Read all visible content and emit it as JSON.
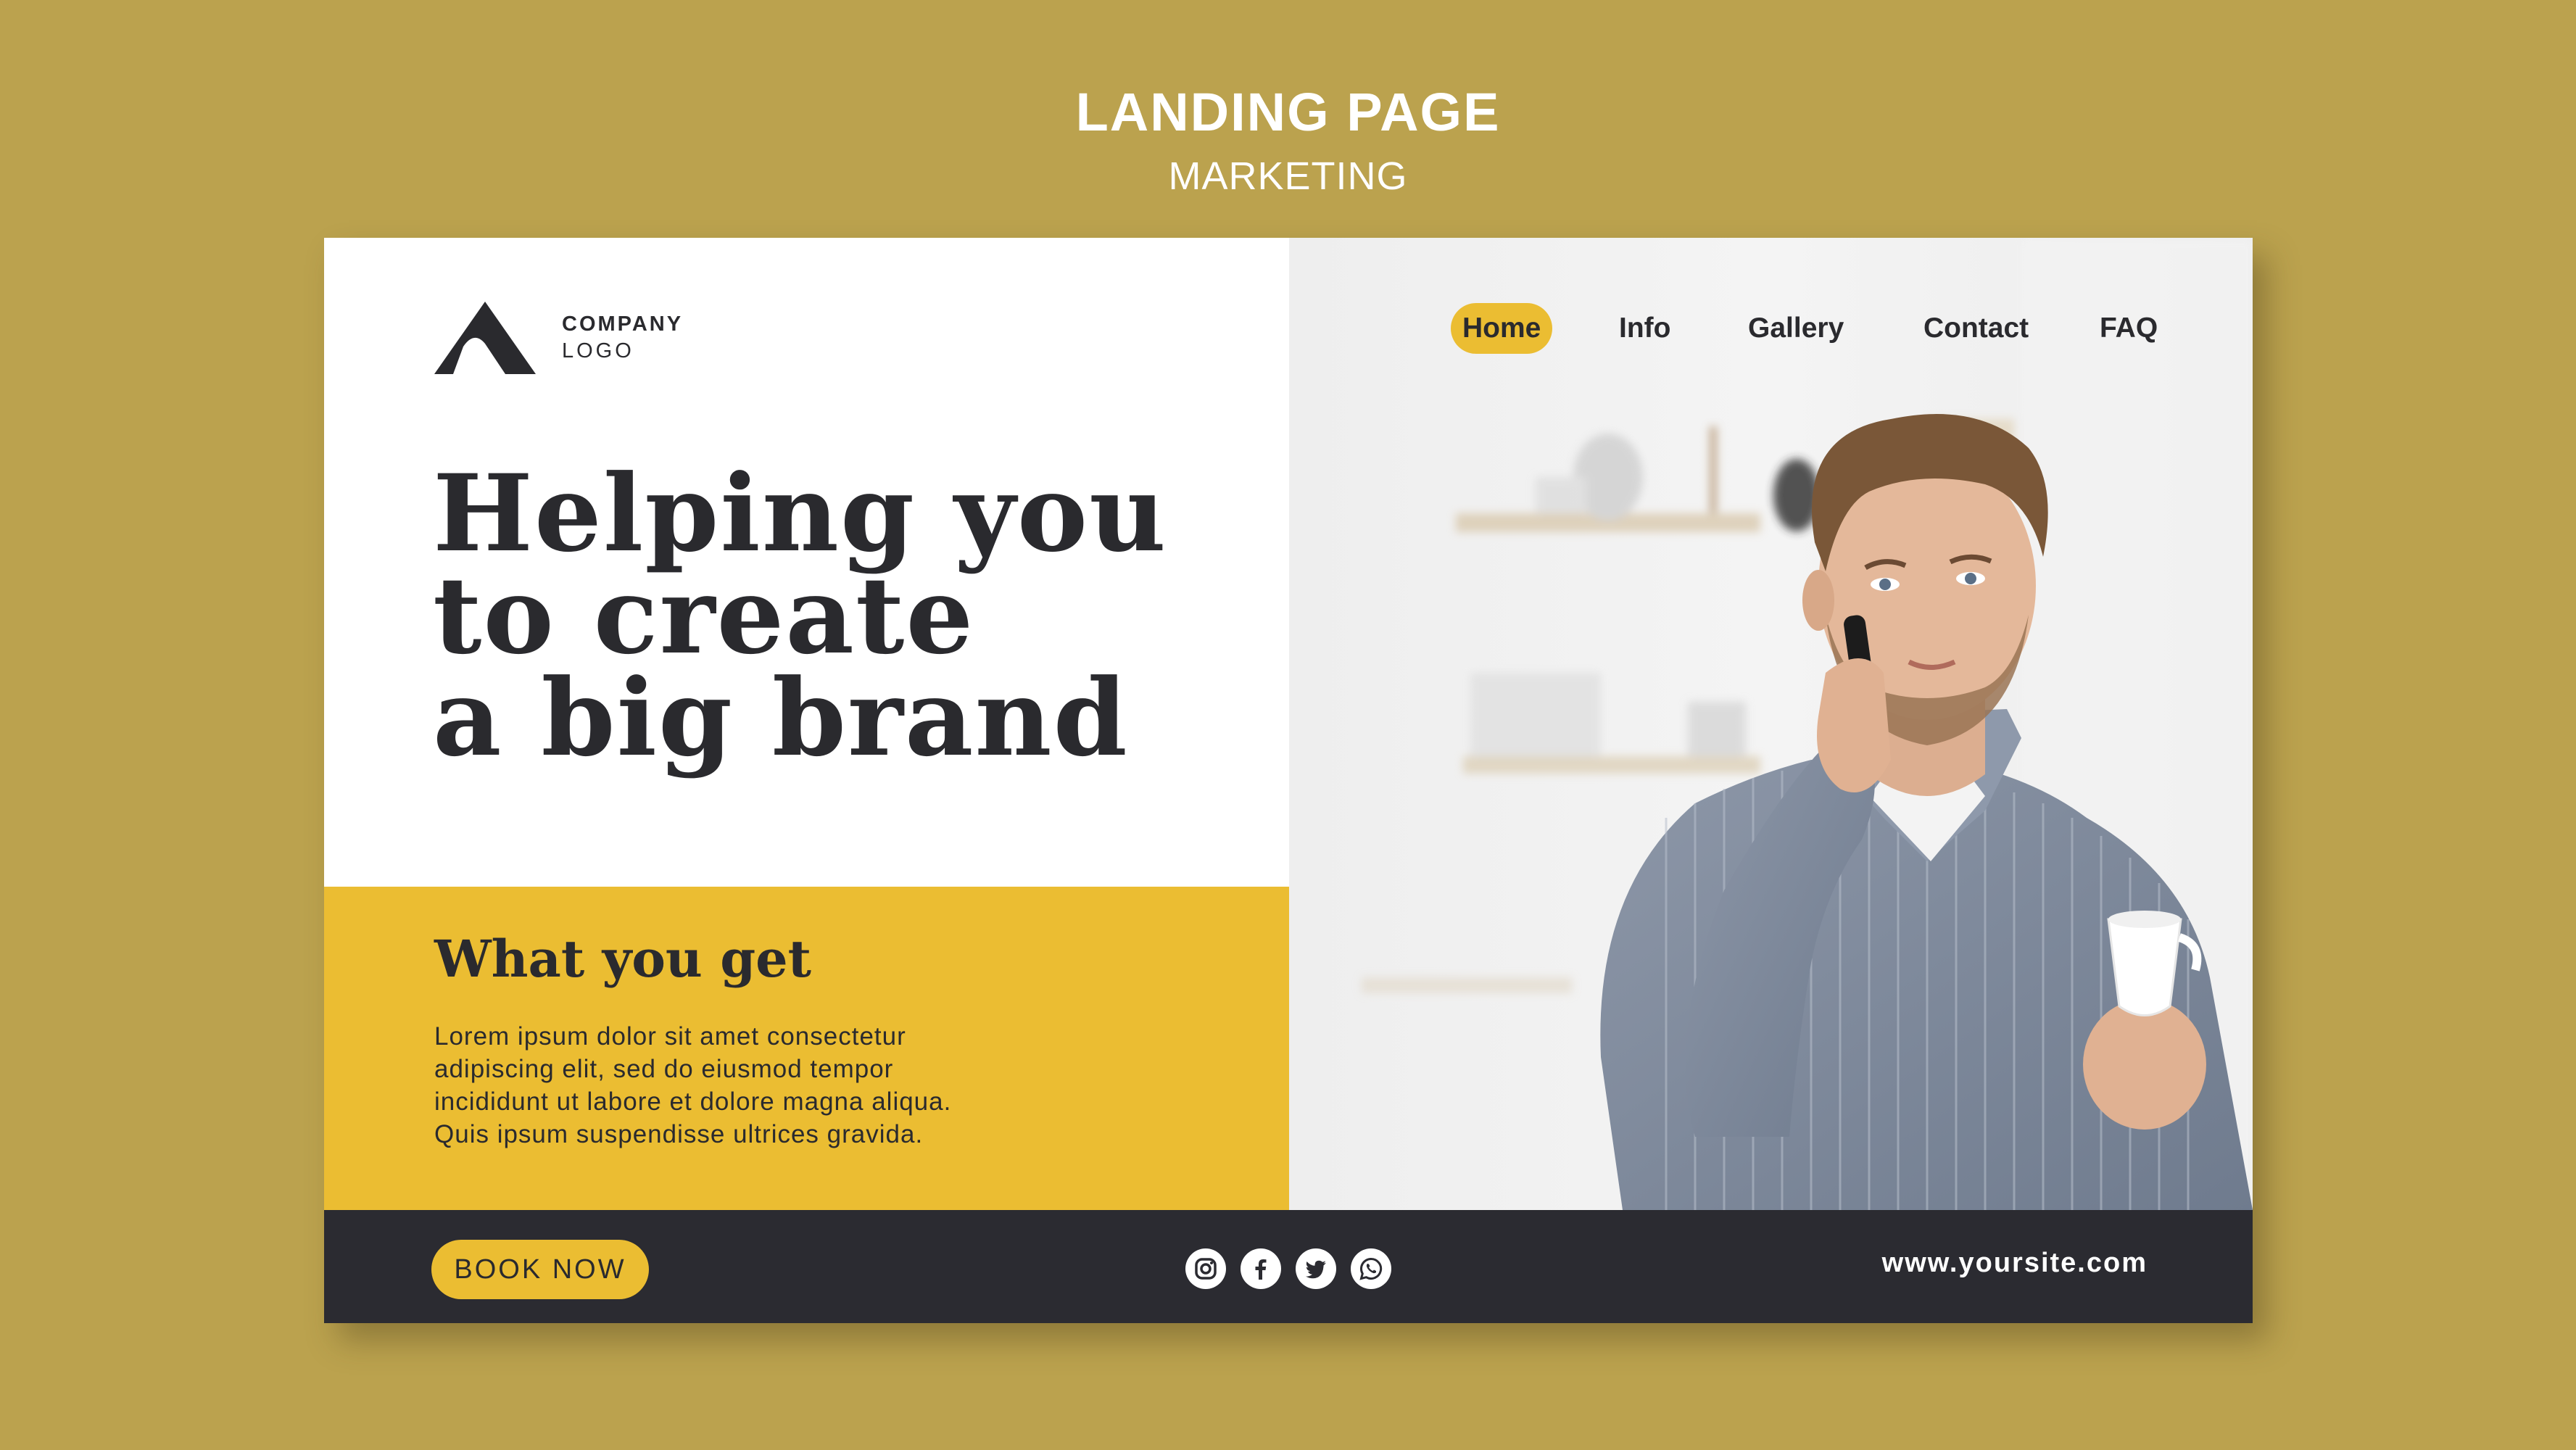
{
  "header": {
    "title": "LANDING PAGE",
    "subtitle": "MARKETING"
  },
  "logo": {
    "line1": "COMPANY",
    "line2": "LOGO"
  },
  "nav": {
    "items": [
      "Home",
      "Info",
      "Gallery",
      "Contact",
      "FAQ"
    ],
    "active": "Home"
  },
  "hero": {
    "lines": [
      "Helping you",
      "to create",
      "a big brand"
    ]
  },
  "benefits": {
    "heading": "What you get",
    "lines": [
      "Lorem ipsum dolor sit amet consectetur",
      "adipiscing elit, sed do eiusmod tempor",
      "incididunt ut labore et dolore magna aliqua.",
      "Quis ipsum suspendisse ultrices gravida."
    ]
  },
  "footer": {
    "cta": "BOOK NOW",
    "socials": [
      "instagram-icon",
      "facebook-icon",
      "twitter-icon",
      "whatsapp-icon"
    ],
    "website": "www.yoursite.com"
  },
  "colors": {
    "background": "#BBA24E",
    "accent": "#EBBD32",
    "dark": "#2b2b31",
    "text": "#2a2a2e"
  }
}
